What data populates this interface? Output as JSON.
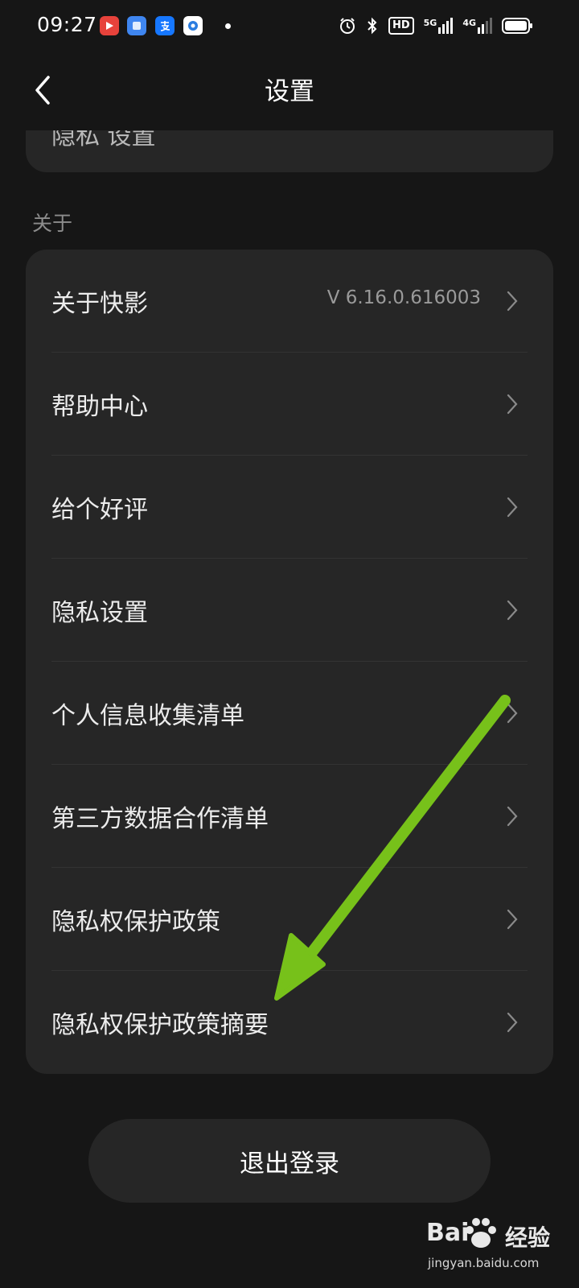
{
  "status_bar": {
    "time": "09:27",
    "notification_icons": [
      "kuaiying-app-icon",
      "blue-square-app-icon",
      "alipay-icon",
      "chat-bubble-app-icon"
    ],
    "system_icons": [
      "alarm-icon",
      "bluetooth-icon",
      "hd-icon",
      "5g-signal-icon",
      "4g-signal-icon",
      "battery-icon"
    ],
    "hd_label": "HD",
    "net1": "5G",
    "net2": "4G"
  },
  "header": {
    "title": "设置",
    "back_icon": "chevron-left-icon"
  },
  "previous_section": {
    "partial_text": "隐私 设置"
  },
  "about_section": {
    "label": "关于",
    "items": [
      {
        "label": "关于快影",
        "value": "V 6.16.0.616003"
      },
      {
        "label": "帮助中心",
        "value": ""
      },
      {
        "label": "给个好评",
        "value": ""
      },
      {
        "label": "隐私设置",
        "value": ""
      },
      {
        "label": "个人信息收集清单",
        "value": ""
      },
      {
        "label": "第三方数据合作清单",
        "value": ""
      },
      {
        "label": "隐私权保护政策",
        "value": ""
      },
      {
        "label": "隐私权保护政策摘要",
        "value": ""
      }
    ]
  },
  "logout_button": "退出登录",
  "annotation": {
    "arrow_color": "#77c11a",
    "icon": "green-arrow-annotation"
  },
  "watermark": {
    "brand": "Bai",
    "brand_suffix": "经验",
    "url": "jingyan.baidu.com"
  },
  "colors": {
    "background": "#161616",
    "card": "#262626",
    "text_primary": "#ececec",
    "text_secondary": "#8c8c8c"
  }
}
